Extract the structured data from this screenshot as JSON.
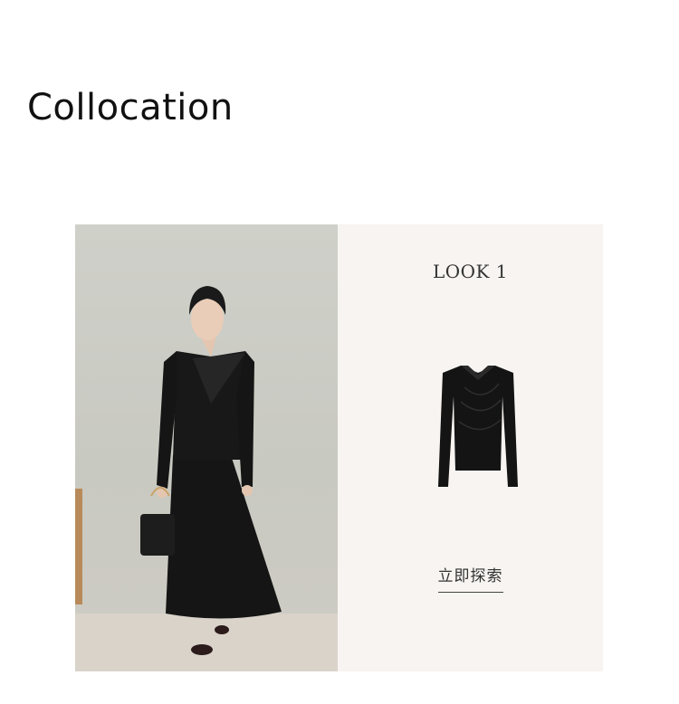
{
  "section": {
    "title": "Collocation"
  },
  "look": {
    "label": "LOOK 1",
    "cta_label": "立即探索",
    "model_image_icon": "model-outfit-photo",
    "product_image_icon": "black-wrap-top"
  },
  "colors": {
    "panel_background": "#f7f4f1",
    "garment": "#141414",
    "text": "#333333"
  }
}
